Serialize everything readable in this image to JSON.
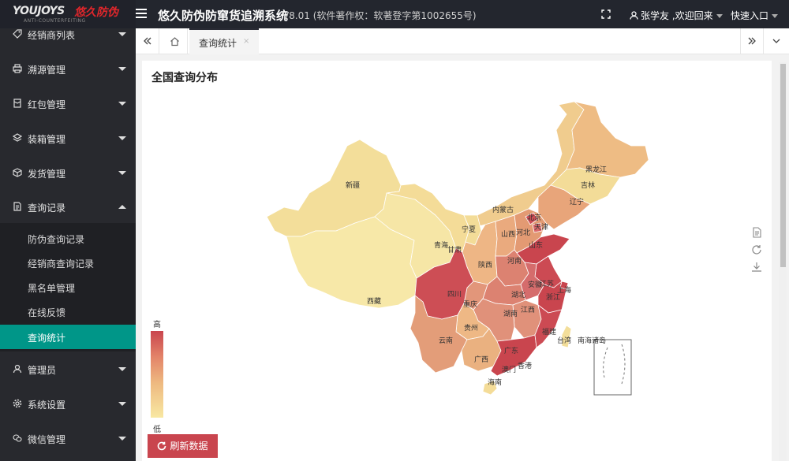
{
  "header": {
    "logo_en": "YOUJOYS",
    "logo_cn": "悠久防伪",
    "logo_sub": "ANTI-COUNTERFEITING",
    "title": "悠久防伪防窜货追溯系统",
    "version": "V8.01 (软件著作权：软著登字第1002655号)",
    "user_label": "张学友 ,欢迎回来",
    "quick_label": "快速入口"
  },
  "sidebar": {
    "items": [
      {
        "label": "经销商列表",
        "icon": "tag-icon"
      },
      {
        "label": "溯源管理",
        "icon": "printer-icon"
      },
      {
        "label": "红包管理",
        "icon": "redpacket-icon"
      },
      {
        "label": "装箱管理",
        "icon": "layers-icon"
      },
      {
        "label": "发货管理",
        "icon": "cube-icon"
      },
      {
        "label": "查询记录",
        "icon": "document-icon"
      },
      {
        "label": "管理员",
        "icon": "user-icon"
      },
      {
        "label": "系统设置",
        "icon": "gear-icon"
      },
      {
        "label": "微信管理",
        "icon": "wechat-icon"
      }
    ],
    "sub_items": [
      {
        "label": "防伪查询记录"
      },
      {
        "label": "经销商查询记录"
      },
      {
        "label": "黑名单管理"
      },
      {
        "label": "在线反馈"
      },
      {
        "label": "查询统计"
      }
    ],
    "active_color": "#009688"
  },
  "tabs": {
    "active_label": "查询统计",
    "close_glyph": "×"
  },
  "content": {
    "title": "全国查询分布",
    "visual_map": {
      "high": "高",
      "low": "低",
      "colors": [
        "#c9454e",
        "#f8e8a2"
      ]
    },
    "refresh_label": "刷新数据"
  },
  "map": {
    "labels": {
      "xinjiang": "新疆",
      "xizang": "西藏",
      "qinghai": "青海",
      "gansu": "甘肃",
      "ningxia": "宁夏",
      "neimenggu": "内蒙古",
      "heilongjiang": "黑龙江",
      "jilin": "吉林",
      "liaoning": "辽宁",
      "beijing": "北京",
      "tianjin": "天津",
      "hebei": "河北",
      "shanxi": "山西",
      "shaanxi": "陕西",
      "shandong": "山东",
      "henan": "河南",
      "sichuan": "四川",
      "chongqing": "重庆",
      "hubei": "湖北",
      "anhui": "安徽",
      "jiangsu": "江苏",
      "shanghai": "上海",
      "zhejiang": "浙江",
      "guizhou": "贵州",
      "hunan": "湖南",
      "jiangxi": "江西",
      "fujian": "福建",
      "yunnan": "云南",
      "guangxi": "广西",
      "guangdong": "广东",
      "hainan": "海南",
      "taiwan": "台湾",
      "xianggang": "香港",
      "aomen": "澳门",
      "nanhai": "南海诸岛"
    }
  }
}
